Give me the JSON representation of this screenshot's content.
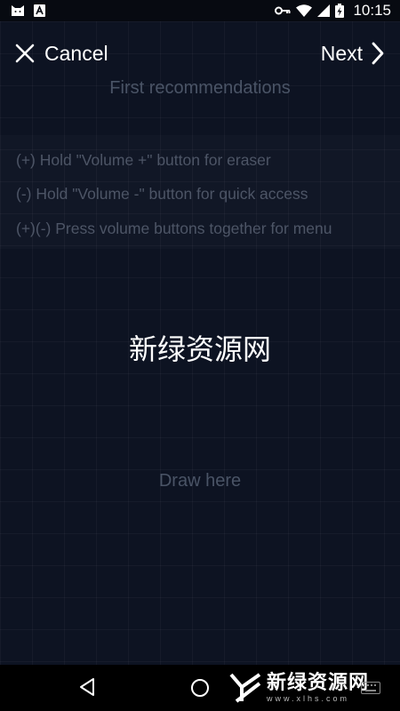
{
  "status_bar": {
    "time": "10:15",
    "icons": [
      "cat-app-icon",
      "font-app-icon",
      "vpn-key-icon",
      "wifi-icon",
      "cellular-signal-icon",
      "battery-charging-icon"
    ]
  },
  "header": {
    "cancel_label": "Cancel",
    "next_label": "Next",
    "subtitle": "First recommendations"
  },
  "tips": [
    "(+) Hold \"Volume +\" button for eraser",
    "(-) Hold \"Volume -\" button for quick access",
    "(+)(-) Press volume buttons together for menu"
  ],
  "canvas": {
    "center_text": "新绿资源网",
    "hint": "Draw here"
  },
  "nav_bar": {
    "buttons": [
      "back-icon",
      "home-icon",
      "keyboard-icon"
    ],
    "watermark_text": "新绿资源网",
    "watermark_url": "www.xlhs.com"
  },
  "colors": {
    "background": "#0d1322",
    "dim_text": "#4a5466",
    "text": "#ffffff"
  }
}
